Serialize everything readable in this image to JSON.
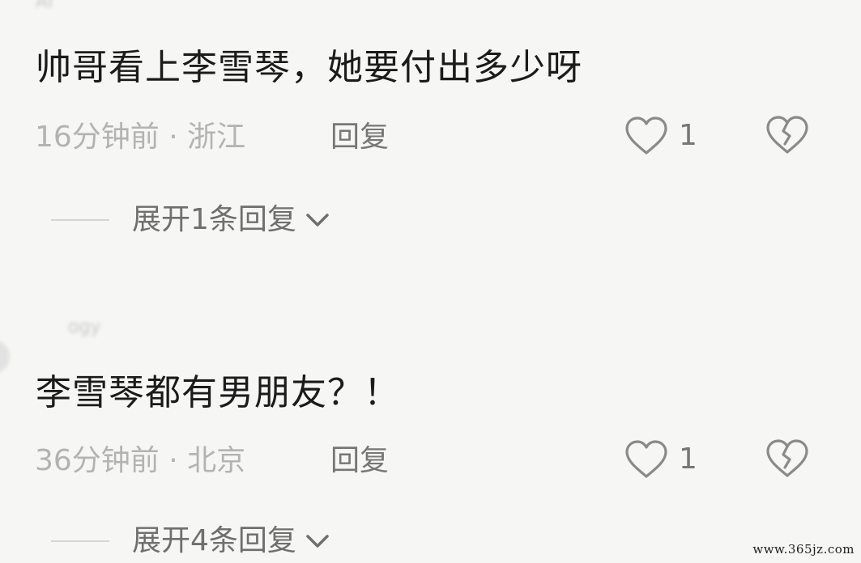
{
  "comments": [
    {
      "username": "AI",
      "text": "帅哥看上李雪琴，她要付出多少呀",
      "time": "16分钟前",
      "location": "浙江",
      "reply_label": "回复",
      "like_count": "1",
      "expand_label": "展开1条回复",
      "like_icon": "heart-outline-icon",
      "dislike_icon": "broken-heart-icon"
    },
    {
      "username": "ogy",
      "text": "李雪琴都有男朋友？！",
      "time": "36分钟前",
      "location": "北京",
      "reply_label": "回复",
      "like_count": "1",
      "expand_label": "展开4条回复",
      "like_icon": "heart-outline-icon",
      "dislike_icon": "broken-heart-icon"
    }
  ],
  "separator": " · ",
  "watermark": "www.365jz.com",
  "colors": {
    "background": "#f6f6f4",
    "text": "#1b1b1b",
    "meta": "#b3b3b3",
    "secondary": "#777777"
  }
}
